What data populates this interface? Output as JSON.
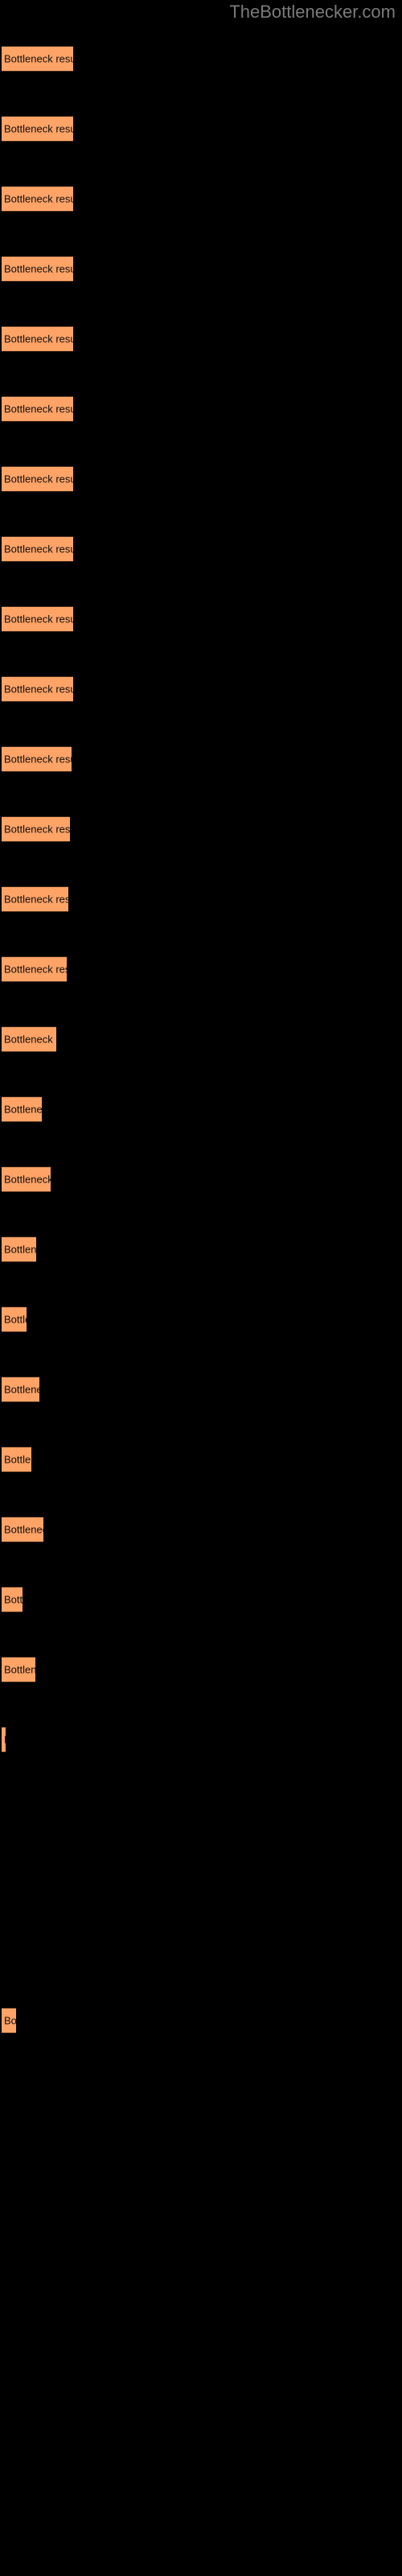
{
  "site": {
    "title": "TheBottlenecker.com",
    "title_color": "#7a7a7a"
  },
  "colors": {
    "background": "#000000",
    "bar_fill": "#ffa366",
    "bar_edge": "#3d2718",
    "bar_text": "#111111"
  },
  "chart_data": {
    "type": "bar",
    "orientation": "horizontal",
    "title": "TheBottlenecker.com",
    "xlabel": "",
    "ylabel": "",
    "grid": false,
    "legend": false,
    "bar_label_text": "Bottleneck result",
    "categories": [
      "Bottleneck result",
      "Bottleneck result",
      "Bottleneck result",
      "Bottleneck result",
      "Bottleneck result",
      "Bottleneck result",
      "Bottleneck result",
      "Bottleneck result",
      "Bottleneck result",
      "Bottleneck result",
      "Bottleneck result",
      "Bottleneck result",
      "Bottleneck result",
      "Bottleneck result",
      "Bottleneck result",
      "Bottleneck result",
      "Bottleneck result",
      "Bottleneck result",
      "Bottleneck result",
      "Bottleneck result",
      "Bottleneck result",
      "Bottleneck result",
      "Bottleneck result",
      "Bottleneck result",
      "Bottleneck result"
    ],
    "values": [
      89,
      89,
      89,
      89,
      89,
      89,
      89,
      89,
      89,
      89,
      89,
      89,
      89,
      89,
      89,
      78,
      66,
      72,
      58,
      48,
      60,
      52,
      62,
      40,
      55
    ],
    "xlim": [
      0,
      500
    ],
    "bars": [
      {
        "label": "Bottleneck result",
        "top": 57,
        "width": 89,
        "value": 89
      },
      {
        "label": "Bottleneck result",
        "top": 144,
        "width": 89,
        "value": 89
      },
      {
        "label": "Bottleneck result",
        "top": 231,
        "width": 89,
        "value": 89
      },
      {
        "label": "Bottleneck result",
        "top": 318,
        "width": 89,
        "value": 89
      },
      {
        "label": "Bottleneck result",
        "top": 405,
        "width": 89,
        "value": 89
      },
      {
        "label": "Bottleneck result",
        "top": 492,
        "width": 89,
        "value": 89
      },
      {
        "label": "Bottleneck result",
        "top": 579,
        "width": 89,
        "value": 89
      },
      {
        "label": "Bottleneck result",
        "top": 666,
        "width": 89,
        "value": 89
      },
      {
        "label": "Bottleneck result",
        "top": 753,
        "width": 89,
        "value": 89
      },
      {
        "label": "Bottleneck result",
        "top": 840,
        "width": 89,
        "value": 89
      },
      {
        "label": "Bottleneck result",
        "top": 927,
        "width": 87,
        "value": 87
      },
      {
        "label": "Bottleneck result",
        "top": 1014,
        "width": 85,
        "value": 85
      },
      {
        "label": "Bottleneck result",
        "top": 1101,
        "width": 83,
        "value": 83
      },
      {
        "label": "Bottleneck result",
        "top": 1188,
        "width": 81,
        "value": 81
      },
      {
        "label": "Bottleneck result",
        "top": 1275,
        "width": 68,
        "value": 68
      },
      {
        "label": "Bottleneck result",
        "top": 1362,
        "width": 50,
        "value": 50
      },
      {
        "label": "Bottleneck result",
        "top": 1449,
        "width": 61,
        "value": 61
      },
      {
        "label": "Bottleneck result",
        "top": 1536,
        "width": 43,
        "value": 43
      },
      {
        "label": "Bottleneck result",
        "top": 1623,
        "width": 31,
        "value": 31
      },
      {
        "label": "Bottleneck result",
        "top": 1710,
        "width": 47,
        "value": 47
      },
      {
        "label": "Bottleneck result",
        "top": 1797,
        "width": 37,
        "value": 37
      },
      {
        "label": "Bottleneck result",
        "top": 1884,
        "width": 52,
        "value": 52
      },
      {
        "label": "Bottleneck result",
        "top": 1971,
        "width": 26,
        "value": 26
      },
      {
        "label": "Bottleneck result",
        "top": 2058,
        "width": 42,
        "value": 42
      },
      {
        "label": "Bottleneck result",
        "top": 2145,
        "width": 5,
        "value": 5
      },
      {
        "label": "Bottleneck result",
        "top": 2494,
        "width": 18,
        "value": 18
      }
    ]
  }
}
